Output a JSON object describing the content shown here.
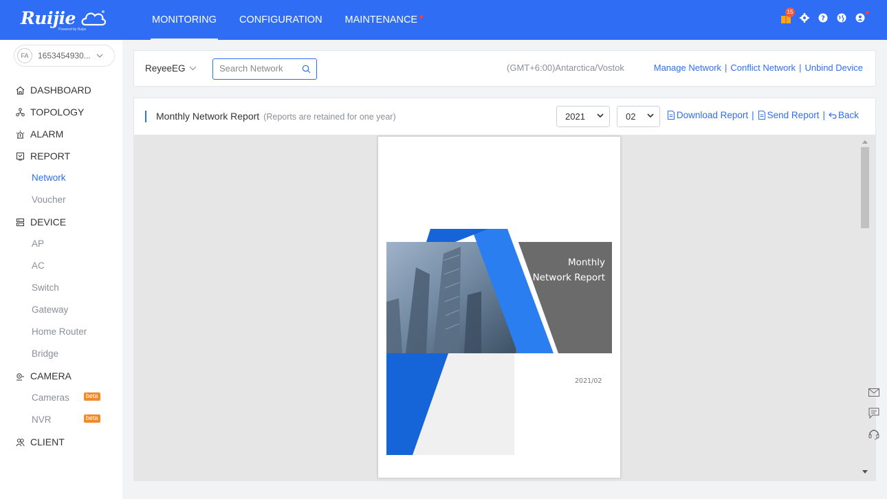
{
  "brand": {
    "logo_text": "Ruijie",
    "logo_sub": "Powered by Ruijie"
  },
  "top_nav": [
    {
      "label": "MONITORING",
      "active": true
    },
    {
      "label": "CONFIGURATION",
      "active": false
    },
    {
      "label": "MAINTENANCE",
      "active": false,
      "dot": true
    }
  ],
  "top_icons": {
    "notification_count": "15",
    "icons": [
      "gift-icon",
      "settings-icon",
      "help-icon",
      "globe-icon",
      "user-icon"
    ]
  },
  "account": {
    "avatar": "FA",
    "id": "1653454930..."
  },
  "sidebar": {
    "dashboard": "DASHBOARD",
    "topology": "TOPOLOGY",
    "alarm": "ALARM",
    "report": "REPORT",
    "report_network": "Network",
    "report_voucher": "Voucher",
    "device": "DEVICE",
    "device_ap": "AP",
    "device_ac": "AC",
    "device_switch": "Switch",
    "device_gateway": "Gateway",
    "device_home_router": "Home Router",
    "device_bridge": "Bridge",
    "camera": "CAMERA",
    "camera_cameras": "Cameras",
    "camera_nvr": "NVR",
    "beta": "beta",
    "client": "CLIENT"
  },
  "header": {
    "network": "ReyeeEG",
    "search_placeholder": "Search Network",
    "timezone": "(GMT+6:00)Antarctica/Vostok",
    "manage_network": "Manage Network",
    "conflict_network": "Conflict Network",
    "unbind_device": "Unbind Device",
    "separator": "|"
  },
  "report": {
    "title": "Monthly Network Report",
    "note": "(Reports are retained for one year)",
    "year": "2021",
    "month": "02",
    "download": "Download Report",
    "send": "Send Report",
    "back": "Back",
    "cover_title_line1": "Monthly",
    "cover_title_line2": "Network Report",
    "cover_date": "2021/02"
  },
  "colors": {
    "primary": "#2f6df4",
    "cover_blue": "#1565d8",
    "cover_gray": "#6b6b6b",
    "beta": "#f08b2c"
  }
}
